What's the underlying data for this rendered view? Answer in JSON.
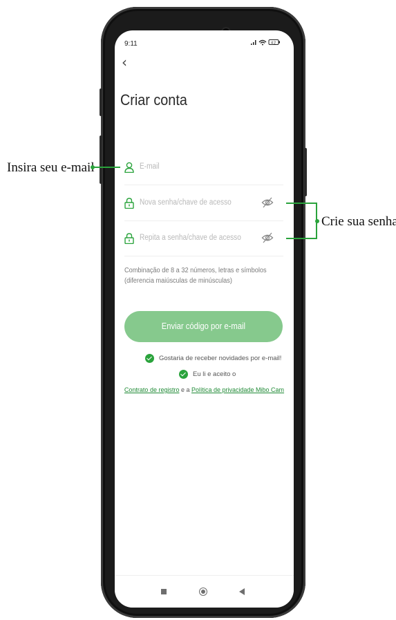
{
  "status": {
    "time": "9:11",
    "icons": "..ıl ᯤ ▭",
    "battery": "42"
  },
  "screen": {
    "back": "‹",
    "title": "Criar conta",
    "fields": [
      {
        "placeholder": "E-mail",
        "icon": "person-icon"
      },
      {
        "placeholder": "Nova senha/chave de acesso",
        "icon": "lock-icon"
      },
      {
        "placeholder": "Repita a senha/chave de acesso",
        "icon": "lock-icon"
      }
    ],
    "hint": "Combinação de 8 a 32 números, letras e símbolos (diferencia maiúsculas de minúsculas)",
    "send_button": "Enviar código por e-mail",
    "newsletter": "Gostaria de receber novidades por e-mail!",
    "accept": "Eu li e aceito o",
    "contract_link": "Contrato de registro",
    "and_text": " e a ",
    "privacy_link": "Política de privacidade Mibo Cam"
  },
  "callouts": {
    "email": "Insira seu e-mail",
    "password": "Crie sua senha"
  },
  "colors": {
    "accent": "#2aa33c",
    "button": "#86c98d"
  }
}
